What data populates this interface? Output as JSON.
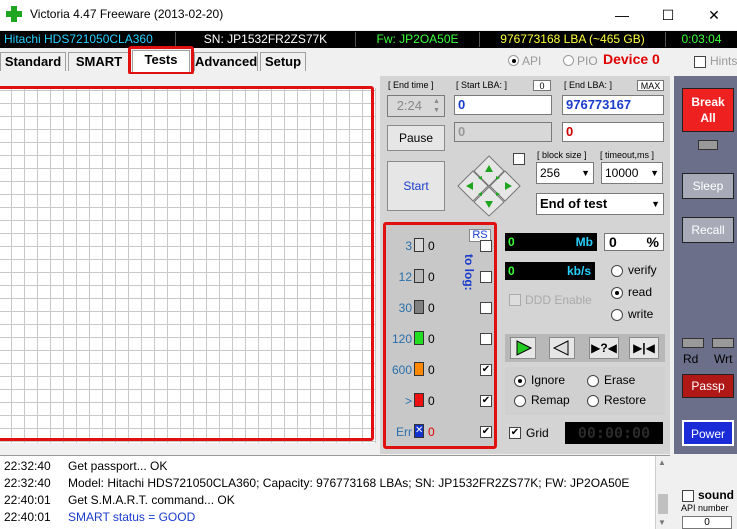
{
  "window": {
    "title": "Victoria 4.47  Freeware (2013-02-20)",
    "minimize": "—",
    "maximize": "☐",
    "close": "✕"
  },
  "infobar": {
    "model": "Hitachi HDS721050CLA360",
    "serial": "SN: JP1532FR2ZS77K",
    "firmware": "Fw: JP2OA50E",
    "lba": "976773168 LBA (~465 GB)",
    "clock": "0:03:04"
  },
  "tabs": [
    "Standard",
    "SMART",
    "Tests",
    "Advanced",
    "Setup"
  ],
  "active_tab": "Tests",
  "mode": {
    "api": "API",
    "pio": "PIO",
    "device": "Device 0",
    "hints": "Hints"
  },
  "controls": {
    "end_time_label": "[ End time ]",
    "end_time_value": "2:24",
    "start_lba_label": "[ Start LBA: ]",
    "start_lba_counter": "0",
    "start_lba_value": "0",
    "end_lba_label": "[ End LBA: ]",
    "end_lba_max": "MAX",
    "end_lba_value": "976773167",
    "current_lba": "0",
    "second_value": "0",
    "pause": "Pause",
    "start": "Start",
    "block_size_label": "[ block size ]",
    "block_size": "256",
    "timeout_label": "[ timeout,ms ]",
    "timeout": "10000",
    "end_action": "End of test",
    "rs": "RS",
    "to_log": "to log:"
  },
  "blocks": [
    {
      "label": "3",
      "count": "0",
      "color": "#d8d8d8",
      "checked": false
    },
    {
      "label": "12",
      "count": "0",
      "color": "#b8b8b8",
      "checked": false
    },
    {
      "label": "30",
      "count": "0",
      "color": "#808080",
      "checked": false
    },
    {
      "label": "120",
      "count": "0",
      "color": "#22dd22",
      "checked": false
    },
    {
      "label": "600",
      "count": "0",
      "color": "#ff8800",
      "checked": true
    },
    {
      "label": ">",
      "count": "0",
      "color": "#ee1111",
      "checked": true
    },
    {
      "label": "Err",
      "count": "0",
      "color": "#1133cc",
      "checked": true
    }
  ],
  "stats": {
    "mb_value": "0",
    "mb_unit": "Mb",
    "pct_value": "0",
    "pct_unit": "%",
    "kbs_value": "0",
    "kbs_unit": "kb/s",
    "ddd": "DDD Enable",
    "verify": "verify",
    "read": "read",
    "write": "write"
  },
  "actions": {
    "ignore": "Ignore",
    "erase": "Erase",
    "remap": "Remap",
    "restore": "Restore",
    "grid": "Grid",
    "timer": "00:00:00"
  },
  "right": {
    "break": "Break All",
    "sleep": "Sleep",
    "recall": "Recall",
    "rd": "Rd",
    "wrt": "Wrt",
    "passp": "Passp",
    "power": "Power",
    "sound": "sound",
    "api_number": "API number",
    "api_value": "0"
  },
  "log": [
    {
      "time": "22:32:40",
      "text": "Get passport... OK",
      "color": "#000000"
    },
    {
      "time": "22:32:40",
      "text": "Model: Hitachi HDS721050CLA360; Capacity: 976773168 LBAs; SN: JP1532FR2ZS77K; FW: JP2OA50E",
      "color": "#000000"
    },
    {
      "time": "22:40:01",
      "text": "Get S.M.A.R.T. command... OK",
      "color": "#000000"
    },
    {
      "time": "22:40:01",
      "text": "SMART status = GOOD",
      "color": "#1a3ccc"
    }
  ]
}
